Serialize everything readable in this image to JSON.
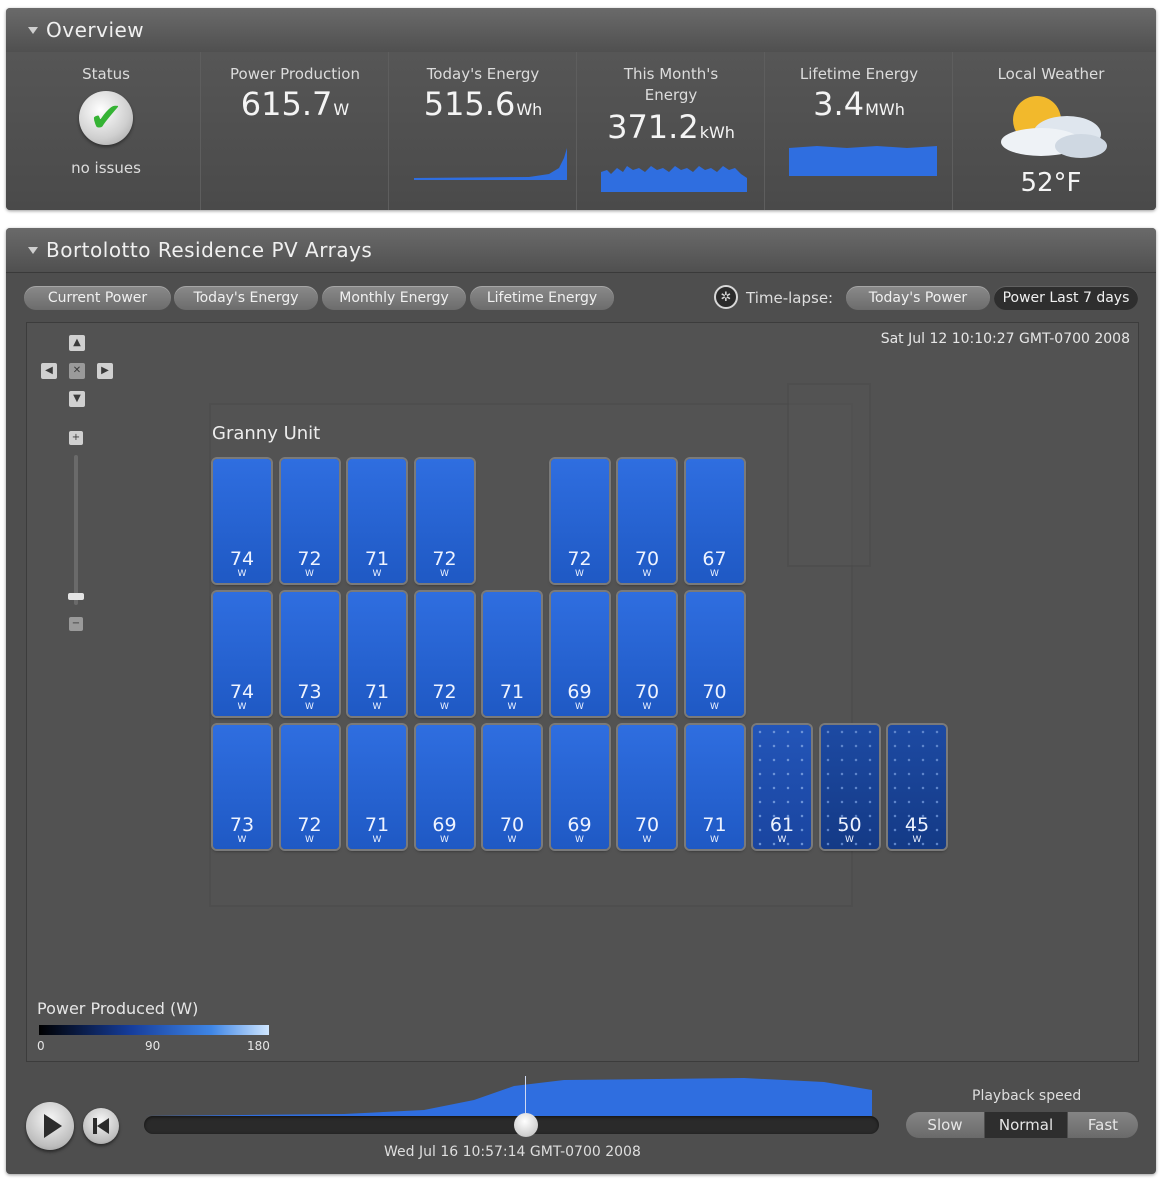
{
  "overview": {
    "title": "Overview",
    "status": {
      "label": "Status",
      "text": "no issues",
      "icon": "check-icon"
    },
    "power_production": {
      "label": "Power Production",
      "value": "615.7",
      "unit": "W"
    },
    "todays_energy": {
      "label": "Today's Energy",
      "value": "515.6",
      "unit": "Wh"
    },
    "month_energy": {
      "label": "This Month's Energy",
      "value": "371.2",
      "unit": "kWh"
    },
    "lifetime_energy": {
      "label": "Lifetime Energy",
      "value": "3.4",
      "unit": "MWh"
    },
    "weather": {
      "label": "Local Weather",
      "temp": "52°F",
      "icon": "sun-cloud-icon"
    }
  },
  "arrays": {
    "title": "Bortolotto Residence PV Arrays",
    "tabs": [
      "Current Power",
      "Today's Energy",
      "Monthly Energy",
      "Lifetime Energy"
    ],
    "timelapse_label": "Time-lapse:",
    "timelapse_tabs": [
      "Today's Power",
      "Power Last 7 days"
    ],
    "timestamp": "Sat Jul 12 10:10:27 GMT-0700 2008",
    "group_label": "Granny Unit",
    "panel_unit": "W",
    "rows": [
      [
        74,
        72,
        71,
        72,
        null,
        72,
        70,
        67
      ],
      [
        74,
        73,
        71,
        72,
        71,
        69,
        70,
        70
      ],
      [
        73,
        72,
        71,
        69,
        70,
        69,
        70,
        71,
        61,
        50,
        45
      ]
    ],
    "legend": {
      "title": "Power Produced (W)",
      "ticks": [
        "0",
        "90",
        "180"
      ],
      "colors": [
        "#000000",
        "#163d9c",
        "#3f86e6",
        "#cfe6ff"
      ]
    }
  },
  "playback": {
    "time": "Wed Jul 16 10:57:14 GMT-0700 2008",
    "speed_label": "Playback speed",
    "speeds": [
      "Slow",
      "Normal",
      "Fast"
    ],
    "selected_speed": "Normal",
    "position": 0.52
  },
  "colors": {
    "accent": "#2f6ee0",
    "panel": "#4e4e4e",
    "ok": "#35b334"
  }
}
